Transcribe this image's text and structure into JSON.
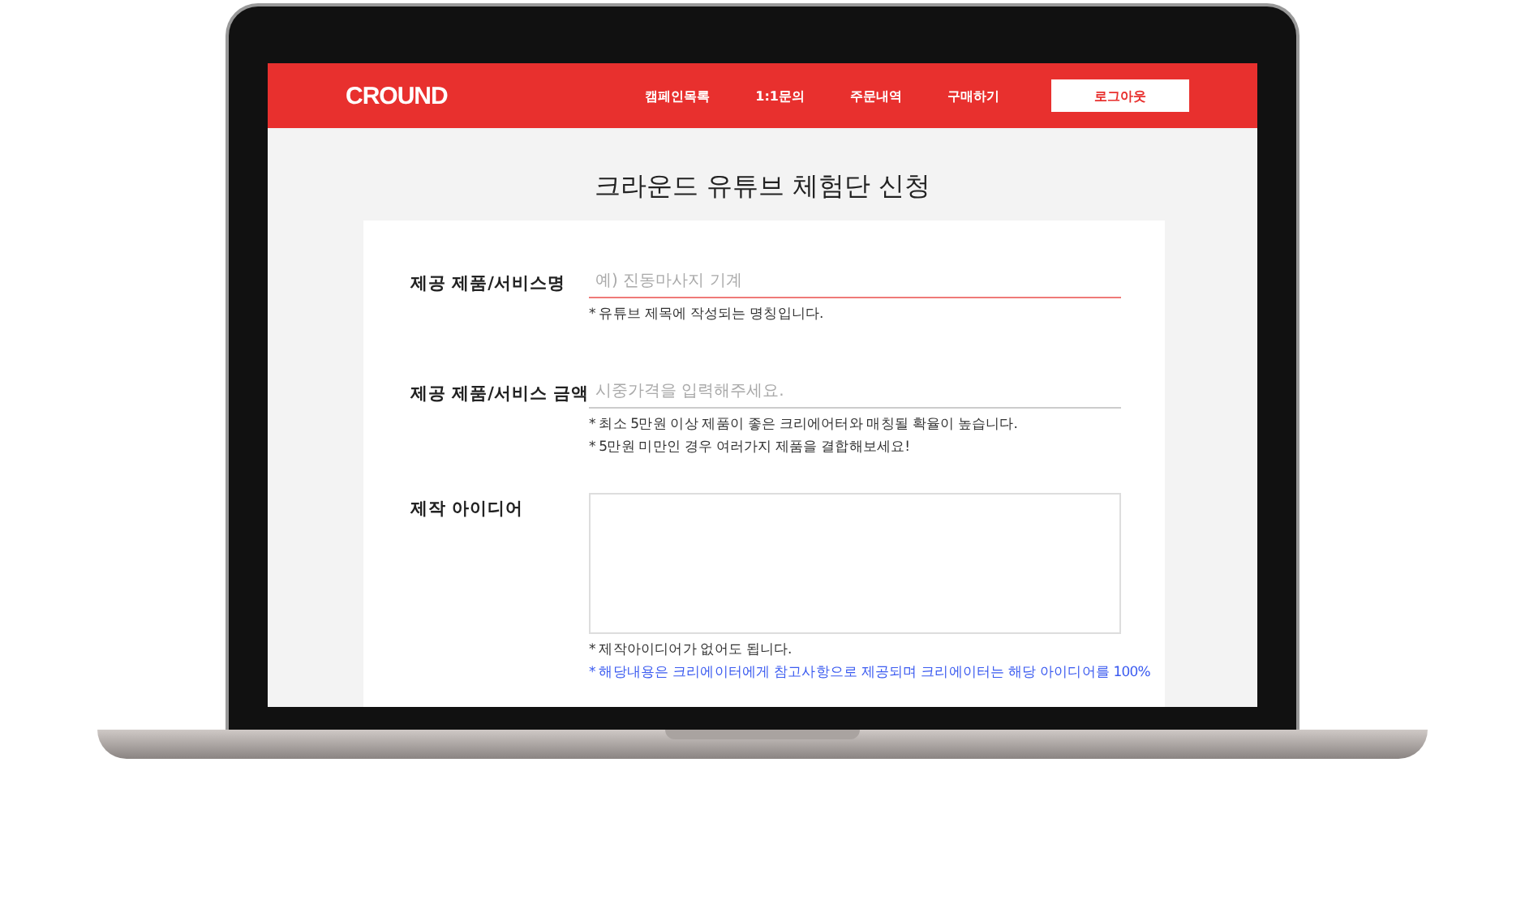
{
  "header": {
    "logo": "CROUND",
    "nav": [
      {
        "label": "캠페인목록"
      },
      {
        "label": "1:1문의"
      },
      {
        "label": "주문내역"
      },
      {
        "label": "구매하기"
      }
    ],
    "logout_button": "로그아웃"
  },
  "page_title": "크라운드 유튜브 체험단 신청",
  "form": {
    "fields": [
      {
        "kind": "text",
        "label": "제공 제품/서비스명",
        "placeholder": "예) 진동마사지 기계",
        "focused": true,
        "notes": [
          {
            "kind": "info",
            "text": "* 유튜브 제목에 작성되는 명칭입니다."
          }
        ]
      },
      {
        "kind": "text",
        "label": "제공 제품/서비스 금액",
        "placeholder": "시중가격을 입력해주세요.",
        "focused": false,
        "notes": [
          {
            "kind": "info",
            "text": "* 최소 5만원 이상 제품이 좋은 크리에어터와 매칭될 확율이 높습니다."
          },
          {
            "kind": "info",
            "text": "* 5만원 미만인 경우 여러가지 제품을 결합해보세요!"
          }
        ]
      },
      {
        "kind": "textarea",
        "label": "제작 아이디어",
        "focused": false,
        "notes": [
          {
            "kind": "info",
            "text": "* 제작아이디어가 없어도 됩니다."
          },
          {
            "kind": "highlight",
            "text": "* 해당내용은 크리에이터에게 참고사항으로 제공되며 크리에이터는 해당 아이디어를 100%"
          }
        ]
      }
    ]
  }
}
